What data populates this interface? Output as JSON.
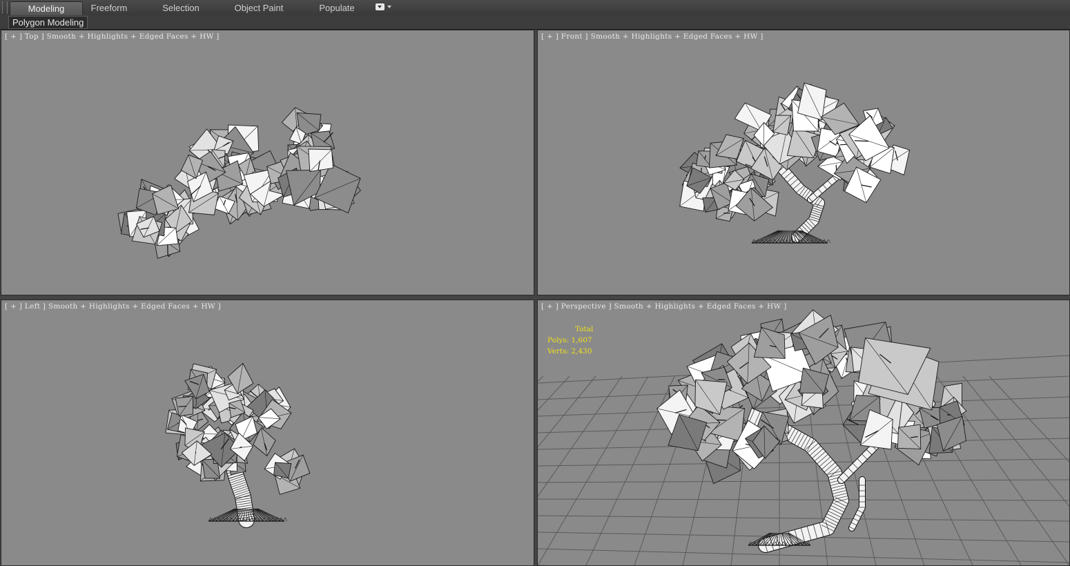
{
  "ribbon": {
    "tabs": [
      "Modeling",
      "Freeform",
      "Selection",
      "Object Paint",
      "Populate"
    ],
    "active_tab": "Modeling",
    "options_icon": "ribbon-options-icon"
  },
  "panel": {
    "label": "Polygon Modeling"
  },
  "viewports": {
    "top": {
      "label": "[ + ] Top ] Smooth + Highlights + Edged Faces + HW ]"
    },
    "front": {
      "label": "[ + ] Front ] Smooth + Highlights + Edged Faces + HW ]"
    },
    "left": {
      "label": "[ + ] Left ] Smooth + Highlights + Edged Faces + HW ]"
    },
    "perspective": {
      "label": "[ + ] Perspective ] Smooth + Highlights + Edged Faces + HW ]",
      "stats": {
        "title": "Total",
        "polys": "Polys: 1,607",
        "verts": "Verts: 2,430"
      }
    }
  },
  "colors": {
    "viewport_bg": "#8a8a8a",
    "stats_text": "#f0e01a",
    "label_text": "#e8e8e8"
  }
}
